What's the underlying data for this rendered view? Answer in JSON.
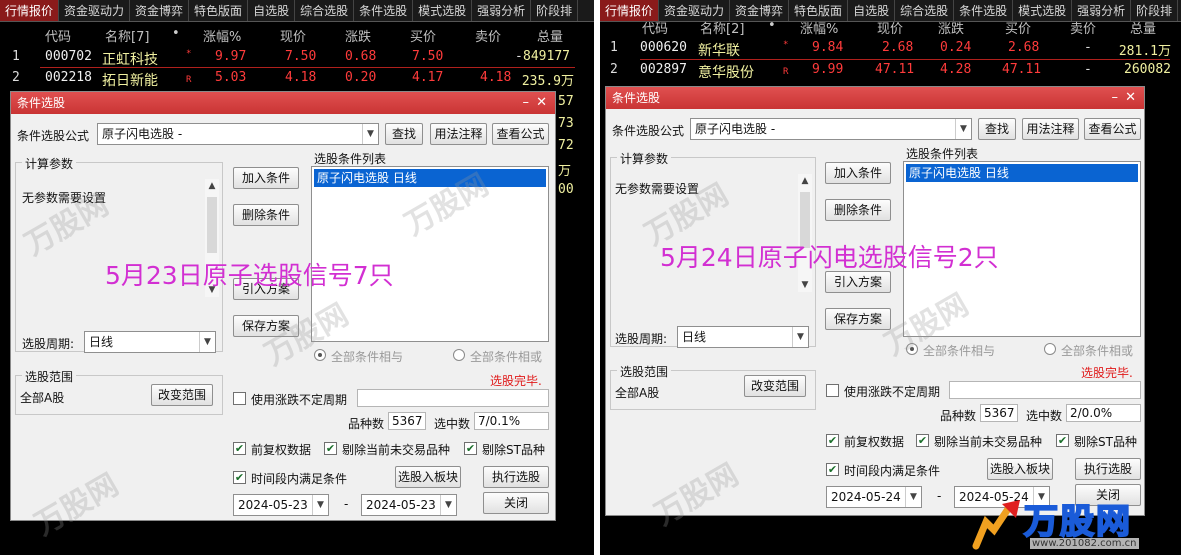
{
  "left": {
    "nav": [
      "行情报价",
      "资金驱动力",
      "资金博弈",
      "特色版面",
      "自选股",
      "综合选股",
      "条件选股",
      "模式选股",
      "强弱分析",
      "阶段排"
    ],
    "headers": [
      "代码",
      "名称[7]",
      "涨幅%",
      "现价",
      "涨跌",
      "买价",
      "卖价",
      "总量"
    ],
    "rows": [
      {
        "idx": "1",
        "code": "000702",
        "name": "正虹科技",
        "mark": "*",
        "pct": "9.97",
        "price": "7.50",
        "chg": "0.68",
        "bid": "7.50",
        "ask": "-",
        "vol": "849177"
      },
      {
        "idx": "2",
        "code": "002218",
        "name": "拓日新能",
        "mark": "R",
        "pct": "5.03",
        "price": "4.18",
        "chg": "0.20",
        "bid": "4.17",
        "ask": "4.18",
        "vol": "235.9万"
      }
    ],
    "edge_values": [
      "57",
      "73",
      "72",
      "万",
      "00"
    ],
    "overlay": "5月23日原子选股信号7只",
    "dialog": {
      "title": "条件选股",
      "formula_label": "条件选股公式",
      "formula_value": "原子闪电选股  -",
      "btn_find": "查找",
      "btn_usage": "用法注释",
      "btn_view": "查看公式",
      "params_group": "计算参数",
      "params_text": "无参数需要设置",
      "btn_add": "加入条件",
      "btn_delete": "删除条件",
      "btn_import": "引入方案",
      "btn_save": "保存方案",
      "list_label": "选股条件列表",
      "list_item": "原子闪电选股  日线",
      "period_label": "选股周期:",
      "period_value": "日线",
      "radio_and": "全部条件相与",
      "radio_or": "全部条件相或",
      "range_group": "选股范围",
      "range_value": "全部A股",
      "btn_change": "改变范围",
      "status": "选股完毕.",
      "chk_uncertain": "使用涨跌不定周期",
      "count_label": "品种数",
      "count_value": "5367",
      "selected_label": "选中数",
      "selected_value": "7/0.1%",
      "chk_adjust": "前复权数据",
      "chk_untraded": "剔除当前未交易品种",
      "chk_st": "剔除ST品种",
      "chk_timespan": "时间段内满足条件",
      "btn_to_block": "选股入板块",
      "btn_exec": "执行选股",
      "date_from": "2024-05-23",
      "date_sep": "-",
      "date_to": "2024-05-23",
      "btn_close": "关闭"
    }
  },
  "right": {
    "nav": [
      "行情报价",
      "资金驱动力",
      "资金博弈",
      "特色版面",
      "自选股",
      "综合选股",
      "条件选股",
      "模式选股",
      "强弱分析",
      "阶段排"
    ],
    "headers": [
      "代码",
      "名称[2]",
      "涨幅%",
      "现价",
      "涨跌",
      "买价",
      "卖价",
      "总量"
    ],
    "rows": [
      {
        "idx": "1",
        "code": "000620",
        "name": "新华联",
        "mark": "*",
        "pct": "9.84",
        "price": "2.68",
        "chg": "0.24",
        "bid": "2.68",
        "ask": "-",
        "vol": "281.1万"
      },
      {
        "idx": "2",
        "code": "002897",
        "name": "意华股份",
        "mark": "R",
        "pct": "9.99",
        "price": "47.11",
        "chg": "4.28",
        "bid": "47.11",
        "ask": "-",
        "vol": "260082"
      }
    ],
    "overlay": "5月24日原子闪电选股信号2只",
    "dialog": {
      "title": "条件选股",
      "formula_label": "条件选股公式",
      "formula_value": "原子闪电选股  -",
      "btn_find": "查找",
      "btn_usage": "用法注释",
      "btn_view": "查看公式",
      "params_group": "计算参数",
      "params_text": "无参数需要设置",
      "btn_add": "加入条件",
      "btn_delete": "删除条件",
      "btn_import": "引入方案",
      "btn_save": "保存方案",
      "list_label": "选股条件列表",
      "list_item": "原子闪电选股  日线",
      "period_label": "选股周期:",
      "period_value": "日线",
      "radio_and": "全部条件相与",
      "radio_or": "全部条件相或",
      "range_group": "选股范围",
      "range_value": "全部A股",
      "btn_change": "改变范围",
      "status": "选股完毕.",
      "chk_uncertain": "使用涨跌不定周期",
      "count_label": "品种数",
      "count_value": "5367",
      "selected_label": "选中数",
      "selected_value": "2/0.0%",
      "chk_adjust": "前复权数据",
      "chk_untraded": "剔除当前未交易品种",
      "chk_st": "剔除ST品种",
      "chk_timespan": "时间段内满足条件",
      "btn_to_block": "选股入板块",
      "btn_exec": "执行选股",
      "date_from": "2024-05-24",
      "date_sep": "-",
      "date_to": "2024-05-24",
      "btn_close": "关闭"
    }
  },
  "watermark": "万股网",
  "logo": {
    "text": "万股网",
    "url": "www.201082.com.cn"
  },
  "colors": {
    "rise": "#ff3b3b",
    "titlebar": "#d33d3d",
    "overlay": "#d22fd2",
    "selection": "#0a64d2"
  }
}
